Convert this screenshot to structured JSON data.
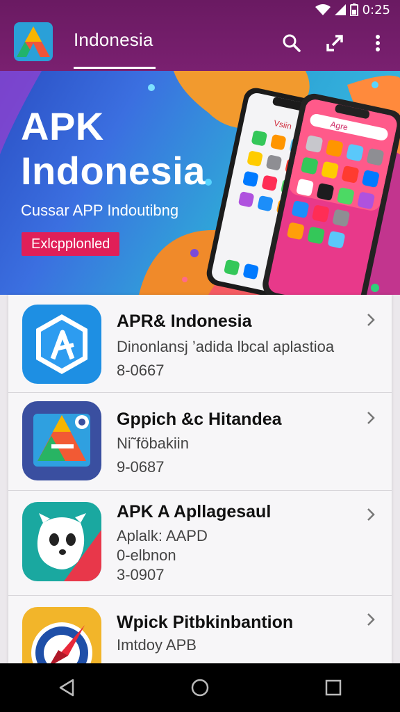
{
  "status_bar": {
    "time": "0:25"
  },
  "app_bar": {
    "title": "Indonesia",
    "actions": [
      "search-icon",
      "share-icon",
      "more-vert-icon"
    ]
  },
  "banner": {
    "title_line1": "APK",
    "title_line2": "Indonesia",
    "subtitle": "Cussar APP Indoutibng",
    "button_label": "Exlcpplonled",
    "phone_front_label": "Agre",
    "phone_back_label": "Vsiin"
  },
  "apps": [
    {
      "name": "APR& Indonesia",
      "line1": "Dinonlansj ’adida lbcal aplastioa",
      "line2": "8-0667",
      "line3": "",
      "icon": "a-hexagon-icon"
    },
    {
      "name": "Gppich &c Hitandea",
      "line1": "Ni˜föbakiin",
      "line2": "9-0687",
      "line3": "",
      "icon": "triangle-logo-icon"
    },
    {
      "name": "APK A Apllagesaul",
      "line1": "Aplalk: AAPD",
      "line2": "0-elbnon",
      "line3": "3-0907",
      "icon": "mascot-icon"
    },
    {
      "name": "Wpick Pitbkinbantion",
      "line1": "Imtdoy APB",
      "line2": "",
      "line3": "",
      "icon": "compass-icon"
    }
  ],
  "colors": {
    "app_bar": "#6a1a62",
    "banner_button": "#e01f58",
    "nav_bar": "#000000"
  },
  "nav": [
    "back-icon",
    "home-icon",
    "recents-icon"
  ]
}
